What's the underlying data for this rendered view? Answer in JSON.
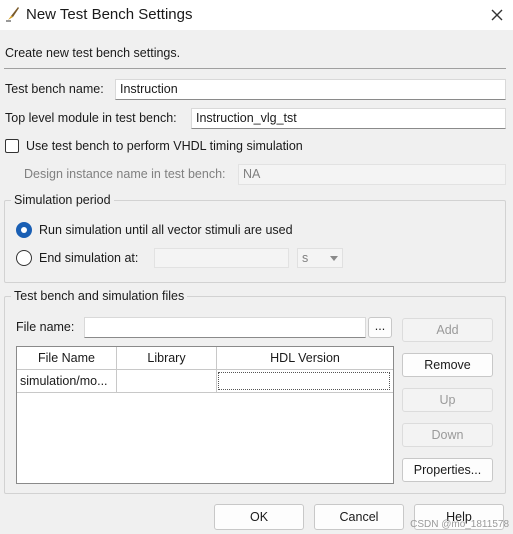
{
  "window": {
    "title": "New Test Bench Settings"
  },
  "intro_text": "Create new test bench settings.",
  "test_bench_name": {
    "label": "Test bench name:",
    "value": "Instruction"
  },
  "top_level_module": {
    "label": "Top level module in test bench:",
    "value": "Instruction_vlg_tst"
  },
  "vhdl_timing": {
    "label": "Use test bench to perform VHDL timing simulation",
    "checked": false
  },
  "design_instance": {
    "label": "Design instance name in test bench:",
    "value": "NA"
  },
  "simulation_period": {
    "title": "Simulation period",
    "run_all_label": "Run simulation until all vector stimuli are used",
    "end_at_label": "End simulation at:",
    "end_at_value": "",
    "unit": "s",
    "selected": "run_all"
  },
  "files": {
    "title": "Test bench and simulation files",
    "file_name_label": "File name:",
    "file_name_value": "",
    "browse_label": "...",
    "columns": [
      "File Name",
      "Library",
      "HDL Version"
    ],
    "rows": [
      {
        "file_name": "simulation/mo...",
        "library": "",
        "hdl_version": ""
      }
    ],
    "buttons": {
      "add": "Add",
      "remove": "Remove",
      "up": "Up",
      "down": "Down",
      "properties": "Properties..."
    }
  },
  "footer": {
    "ok": "OK",
    "cancel": "Cancel",
    "help": "Help"
  },
  "watermark": "CSDN @mo_1811578"
}
